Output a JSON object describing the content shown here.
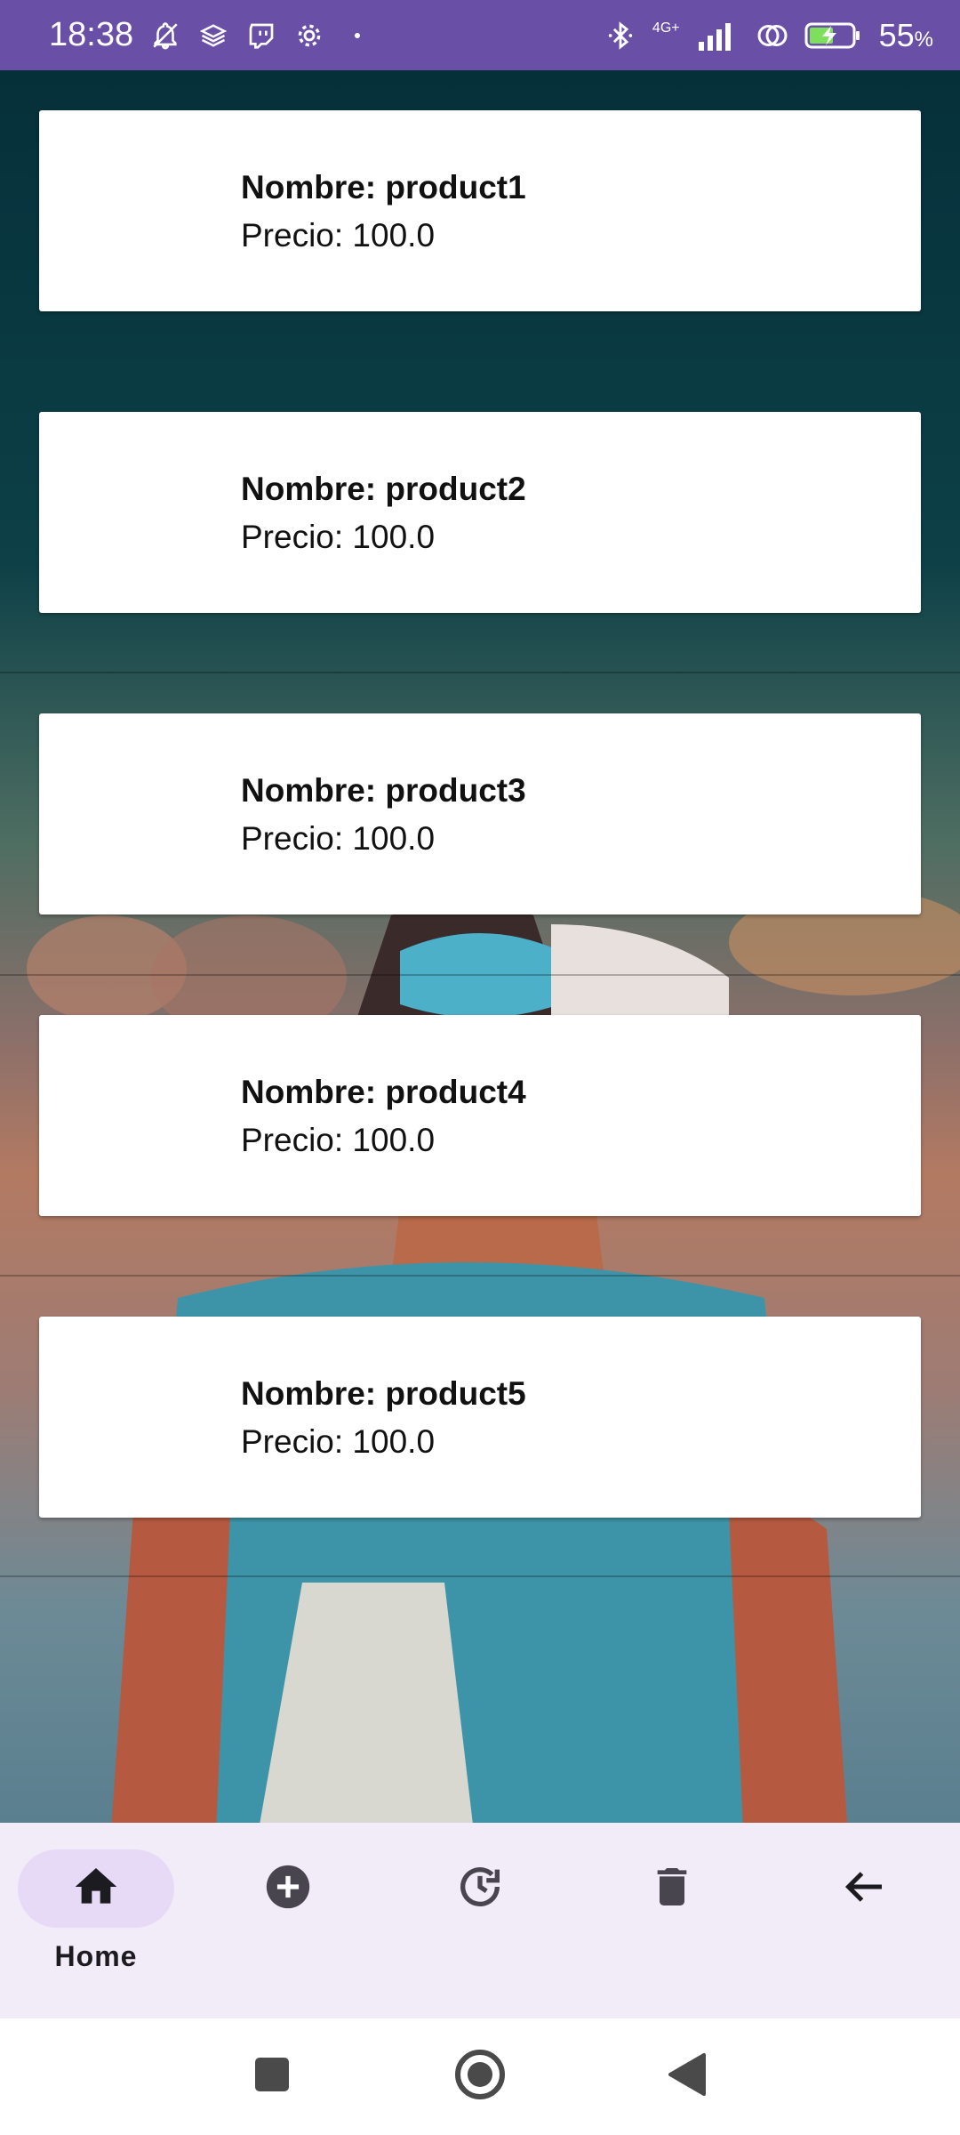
{
  "status_bar": {
    "time": "18:38",
    "network": "4G+",
    "battery_percent": "55",
    "battery_unit": "%",
    "icons_left": [
      "bell-off-icon",
      "layers-icon",
      "twitch-icon",
      "gear-icon",
      "dot-icon"
    ],
    "icons_right": [
      "bluetooth-icon",
      "signal-icon",
      "hotspot-icon",
      "battery-charging-icon"
    ]
  },
  "products": [
    {
      "name": "Nombre: product1",
      "price": "Precio: 100.0"
    },
    {
      "name": "Nombre: product2",
      "price": "Precio: 100.0"
    },
    {
      "name": "Nombre: product3",
      "price": "Precio: 100.0"
    },
    {
      "name": "Nombre: product4",
      "price": "Precio: 100.0"
    },
    {
      "name": "Nombre: product5",
      "price": "Precio: 100.0"
    }
  ],
  "bottom_nav": {
    "items": [
      {
        "label": "Home",
        "icon": "home-icon",
        "active": true
      },
      {
        "icon": "add-circle-icon"
      },
      {
        "icon": "history-icon"
      },
      {
        "icon": "delete-icon"
      },
      {
        "icon": "arrow-back-icon"
      }
    ]
  },
  "system_nav": [
    "recents-square-icon",
    "home-circle-icon",
    "back-triangle-icon"
  ],
  "colors": {
    "status_bar": "#6a4fa6",
    "card": "#ffffff",
    "nav_background": "#f2ebf8",
    "nav_active_pill": "#e7daf6",
    "icon": "#49454f"
  }
}
